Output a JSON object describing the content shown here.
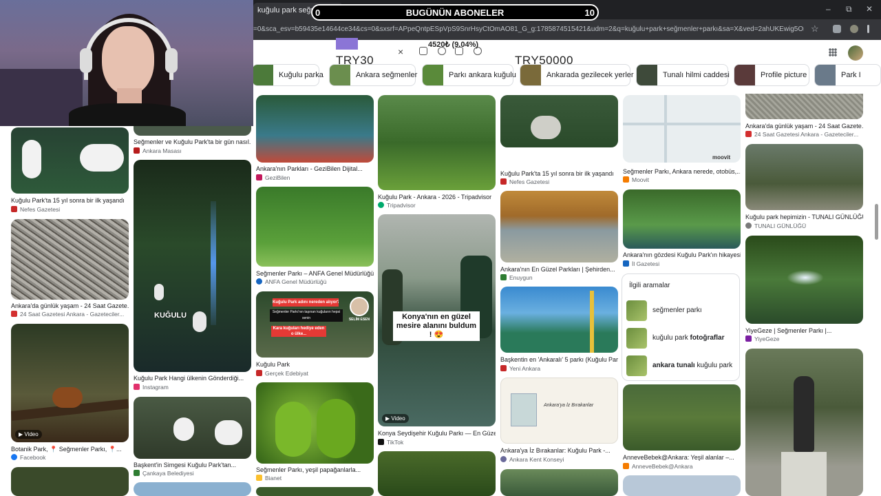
{
  "browser": {
    "tab_title": "kuğulu park seğmenler parkı",
    "url": "=0&sca_esv=b59435e14644ce34&cs=0&sxsrf=APpeQntpESpVpS9SnrHsyCtOmAO81_G_g:1785874515421&udm=2&q=kuğulu+park+seğmenler+parkı&sa=X&ved=2ahUKEwig5OmA5YeWAx...",
    "new_tab": "+",
    "close_tab": "×",
    "window_minimize": "–",
    "window_restore": "⧉",
    "window_close": "✕",
    "bookmark": "☆"
  },
  "overlay": {
    "left_count": "0",
    "title": "BUGÜNÜN ABONELER",
    "right_count": "10"
  },
  "donation": {
    "amount_pct": "4520₺ (9.04%)",
    "goal_start": "TRY30",
    "goal_end": "TRY50000",
    "progress_fraction": 0.0904
  },
  "search": {
    "clear": "×"
  },
  "chips": [
    {
      "label": "Kuğulu parka",
      "color": "#4c7a3a"
    },
    {
      "label": "Ankara seğmenler",
      "color": "#6b8e4e"
    },
    {
      "label": "Parkı ankara kuğulu",
      "color": "#5a8a3a"
    },
    {
      "label": "Ankarada gezilecek yerler",
      "color": "#7a6a3a"
    },
    {
      "label": "Tunalı hilmi caddesi",
      "color": "#3e4a3a"
    },
    {
      "label": "Profile picture",
      "color": "#5a3a3a"
    },
    {
      "label": "Park I",
      "color": "#6a7a8a"
    }
  ],
  "results": {
    "col1": [
      {
        "title": "Kuğulu Park'ta 15 yıl sonra bir ilk yaşandı",
        "source": "Nefes Gazetesi",
        "src_color": "#c62828",
        "img": "#2e4a2e"
      },
      {
        "title": "Ankara'da günlük yaşam - 24 Saat Gazete...",
        "source": "24 Saat Gazetesi Ankara - Gazeteciler...",
        "src_color": "#d32f2f",
        "img": "#8b8a85"
      },
      {
        "title": "Botanik Park, 📍 Seğmenler Parkı, 📍...",
        "source": "Facebook",
        "src_color": "#1877f2",
        "img": "#2e3a22",
        "video": "Video"
      }
    ],
    "col2": [
      {
        "title": "Seğmenler ve Kuğulu Park'ta bir gün nasıl...",
        "source": "Ankara Masası",
        "src_color": "#b71c1c"
      },
      {
        "title": "Kuğulu Park Hangi ülkenin Gönderdiği...",
        "source": "Instagram",
        "src_color": "#e1306c",
        "img": "#1b2a1c",
        "overlay": "KUĞULU"
      },
      {
        "title": "Başkent'in Simgesi Kuğulu Park'tan...",
        "source": "Çankaya Belediyesi",
        "src_color": "#2e7d32",
        "img": "#45503c"
      }
    ],
    "col3": [
      {
        "title": "Ankara'nın Parkları - GeziBilen Dijital...",
        "source": "GeziBilen",
        "src_color": "#c2185b",
        "img": "#2a5a6a"
      },
      {
        "title": "Seğmenler Parkı – ANFA Genel Müdürlüğü",
        "source": "ANFA Genel Müdürlüğü",
        "src_color": "#1565c0",
        "img": "#3f8a2f"
      },
      {
        "title": "Kuğulu Park",
        "source": "Gerçek Edebiyat",
        "src_color": "#c62828",
        "img": "#3a5a2a",
        "badge_top": "Kuğulu Park adını nereden alıyor?",
        "badge_mid": "Seğmenler Parkı'nın taşınan kuğuların hepsi senin",
        "badge_bot": "Kara kuğuları hediye eden o ülke...",
        "badge_name": "SELİM ESEN"
      },
      {
        "title": "Seğmenler Parkı, yeşil papağanlarla...",
        "source": "Bianet",
        "src_color": "#fbc02d",
        "img": "#5f9a2a"
      }
    ],
    "col4": [
      {
        "title": "Kuğulu Park - Ankara - 2026 - Tripadvisor",
        "source": "Tripadvisor",
        "src_color": "#00aa6c",
        "img": "#3f7a2f"
      },
      {
        "title": "Konya Seydişehir Kuğulu Parkı — En Güzel...",
        "source": "TikTok",
        "src_color": "#111111",
        "img": "#6a7a72",
        "video": "Video",
        "caption": "Konya'nın en güzel mesire alanını buldum ! 😍"
      }
    ],
    "col5": [
      {
        "title": "Kuğulu Park'ta 15 yıl sonra bir ilk yaşandı",
        "source": "Nefes Gazetesi",
        "src_color": "#c62828",
        "img": "#3a5a3a"
      },
      {
        "title": "Ankara'nın En Güzel Parkları | Şehirden...",
        "source": "Enuygun",
        "src_color": "#2e7d32",
        "img": "#a06a2a"
      },
      {
        "title": "Başkentin en 'Ankaralı' 5 parkı (Kuğulu Par...",
        "source": "Yeni Ankara",
        "src_color": "#c62828",
        "img": "#3a7ab0"
      },
      {
        "title": "Ankara'ya İz Bırakanlar: Kuğulu Park -...",
        "source": "Ankara Kent Konseyi",
        "src_color": "#6a6a9a",
        "img": "#f5f2ea",
        "card_text": "Ankara'ya İz Bırakanlar"
      }
    ],
    "col6": [
      {
        "title": "Seğmenler Parkı, Ankara nerede, otobüs,...",
        "source": "Moovit",
        "src_color": "#f57c00",
        "img": "#e8ecef",
        "map_label": "moovit"
      },
      {
        "title": "Ankara'nın gözdesi Kuğulu Park'ın hikayesi...",
        "source": "İl Gazetesi",
        "src_color": "#1565c0",
        "img": "#3a7a3a"
      },
      {
        "title": "AnneveBebek@Ankara: Yeşil alanlar –...",
        "source": "AnneveBebek@Ankara",
        "src_color": "#f57c00",
        "img": "#4a6a3a"
      }
    ],
    "col7": [
      {
        "title": "Ankara'da günlük yaşam - 24 Saat Gazete...",
        "source": "24 Saat Gazetesi Ankara - Gazeteciler...",
        "src_color": "#d32f2f",
        "img": "#7a7a70"
      },
      {
        "title": "Kuğulu park hepimizin - TUNALI GÜNLÜĞÜ",
        "source": "TUNALI GÜNLÜĞÜ",
        "src_color": "#7a7a7a",
        "img": "#5a6a4a"
      },
      {
        "title": "YiyeGeze | Seğmenler Parkı |...",
        "source": "YiyeGeze",
        "src_color": "#7b1fa2",
        "img": "#3a5a2a"
      }
    ]
  },
  "related": {
    "title": "İlgili aramalar",
    "items": [
      {
        "prefix": "seğmenler parkı",
        "bold": ""
      },
      {
        "prefix": "kuğulu park ",
        "bold": "fotoğraflar"
      },
      {
        "prefix": "kuğulu park",
        "bold": "ankara tunalı "
      }
    ]
  }
}
